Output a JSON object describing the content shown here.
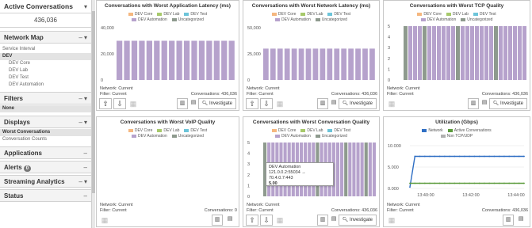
{
  "sidebar": {
    "active_conversations": {
      "title": "Active Conversations",
      "ctl": "▾",
      "value": "436,036"
    },
    "network_map": {
      "title": "Network Map",
      "ctl": "–  ▾",
      "items": [
        {
          "label": "Service Interval",
          "selected": false,
          "sub": false
        },
        {
          "label": "DEV",
          "selected": true,
          "sub": false
        },
        {
          "label": "DEV Core",
          "selected": false,
          "sub": true
        },
        {
          "label": "DEV Lab",
          "selected": false,
          "sub": true
        },
        {
          "label": "DEV Test",
          "selected": false,
          "sub": true
        },
        {
          "label": "DEV Automation",
          "selected": false,
          "sub": true
        }
      ]
    },
    "filters": {
      "title": "Filters",
      "ctl": "–  ▾",
      "items": [
        {
          "label": "None"
        }
      ]
    },
    "displays": {
      "title": "Displays",
      "ctl": "–  ▾",
      "items": [
        {
          "label": "Worst Conversations"
        },
        {
          "label": "Conversation Counts"
        }
      ]
    },
    "applications": {
      "title": "Applications",
      "ctl": "–"
    },
    "alerts": {
      "title": "Alerts",
      "badge": "0",
      "ctl": "–"
    },
    "streaming": {
      "title": "Streaming Analytics",
      "ctl": "–  ▾"
    },
    "status": {
      "title": "Status",
      "ctl": "–"
    }
  },
  "colors": {
    "dev_core": "#f5b77f",
    "dev_lab": "#a7c96b",
    "dev_test": "#6cc4d9",
    "dev_automation": "#b6a2cc",
    "uncategorized": "#8e9a8e",
    "network": "#2f6fc4",
    "active": "#5b9b3c",
    "non_tcp": "#b0b0b0"
  },
  "legend_std": {
    "row1": [
      "DEV Core",
      "DEV Lab",
      "DEV Test"
    ],
    "row2": [
      "DEV Automation",
      "Uncategorized"
    ]
  },
  "legend_util": {
    "row1": [
      "Network",
      "Active Conversations"
    ],
    "row2": [
      "Non TCP/UDP"
    ]
  },
  "panels": [
    {
      "title": "Conversations with Worst Application Latency (ms)",
      "network": "Network: Current",
      "filter": "Filter: Current",
      "conv": "Conversations: 436,036",
      "invest": "Investigate",
      "arrows": true,
      "ticks": [
        "40,000",
        "20,000",
        "0"
      ]
    },
    {
      "title": "Conversations with Worst Network Latency (ms)",
      "network": "Network: Current",
      "filter": "Filter: Current",
      "conv": "Conversations: 436,036",
      "invest": "Investigate",
      "arrows": true,
      "ticks": [
        "50,000",
        "25,000",
        "0"
      ]
    },
    {
      "title": "Conversations with Worst TCP Quality",
      "network": "Network: Current",
      "filter": "Filter: Current",
      "conv": "Conversations: 436,036",
      "invest": "Investigate",
      "arrows": false,
      "ticks": [
        "5",
        "4",
        "3",
        "2",
        "1",
        "0"
      ]
    },
    {
      "title": "Conversations with Worst VoIP Quality",
      "network": "Network: Current",
      "filter": "Filter: Current",
      "conv": "Conversations: 0",
      "invest": "",
      "arrows": false,
      "ticks": []
    },
    {
      "title": "Conversations with Worst Conversation Quality",
      "network": "Network: Current",
      "filter": "Filter: Current",
      "conv": "Conversations: 436,036",
      "invest": "Investigate",
      "arrows": true,
      "ticks": [
        "5",
        "4",
        "3",
        "2",
        "1",
        "0"
      ]
    },
    {
      "title": "Utilization (Gbps)",
      "network": "Network: Current",
      "filter": "Filter: Current",
      "conv": "Conversations: 436,036",
      "invest": "",
      "arrows": false,
      "ticks": [
        "10.000",
        "5.000",
        "0.000"
      ],
      "xticks": [
        "13:40:00",
        "13:42:00",
        "13:44:00"
      ]
    }
  ],
  "tooltip": {
    "label": "DEV Automation",
    "addr": "121.0.0.2:55034 → 70.4.0.7:443",
    "value": "5.00"
  },
  "chart_data": [
    {
      "type": "bar",
      "title": "Conversations with Worst Application Latency (ms)",
      "ylim": [
        0,
        40000
      ],
      "series": [
        {
          "name": "DEV Automation",
          "values": [
            30000,
            30000,
            30000,
            30000,
            30000,
            30000,
            30000,
            30000,
            30000,
            30000,
            30000,
            30000,
            30000,
            30000,
            30000,
            30000
          ]
        }
      ]
    },
    {
      "type": "bar",
      "title": "Conversations with Worst Network Latency (ms)",
      "ylim": [
        0,
        50000
      ],
      "series": [
        {
          "name": "DEV Automation",
          "values": [
            30000,
            30000,
            30000,
            30000,
            30000,
            30000,
            30000,
            30000,
            30000,
            30000,
            30000,
            30000,
            30000,
            30000,
            30000,
            30000
          ]
        }
      ]
    },
    {
      "type": "bar",
      "title": "Conversations with Worst TCP Quality",
      "ylim": [
        0,
        5
      ],
      "series": [
        {
          "name": "mixed",
          "values": [
            5,
            5,
            5,
            5,
            5,
            5,
            5,
            5,
            5,
            5,
            5,
            5,
            5,
            5,
            5,
            5,
            5,
            5,
            5,
            5,
            5,
            5,
            5,
            5,
            5,
            5
          ]
        }
      ],
      "colors": [
        "u",
        "a",
        "a",
        "a",
        "u",
        "a",
        "a",
        "a",
        "a",
        "a",
        "a",
        "u",
        "a",
        "a",
        "a",
        "a",
        "a",
        "a",
        "a",
        "u",
        "a",
        "a",
        "a",
        "a",
        "a",
        "a"
      ]
    },
    {
      "type": "bar",
      "title": "Conversations with Worst VoIP Quality",
      "series": []
    },
    {
      "type": "bar",
      "title": "Conversations with Worst Conversation Quality",
      "ylim": [
        0,
        5
      ],
      "series": [
        {
          "name": "mixed",
          "values": [
            5,
            5,
            5,
            5,
            5,
            5,
            5,
            5,
            5,
            5,
            5,
            5,
            5,
            5,
            5,
            5,
            5,
            5,
            5,
            5,
            5,
            5,
            5,
            5,
            5,
            5,
            5,
            5
          ]
        }
      ],
      "colors": [
        "u",
        "a",
        "a",
        "a",
        "a",
        "a",
        "a",
        "a",
        "a",
        "a",
        "a",
        "a",
        "a",
        "u",
        "a",
        "a",
        "a",
        "a",
        "a",
        "a",
        "u",
        "a",
        "a",
        "a",
        "a",
        "u",
        "a",
        "a"
      ]
    },
    {
      "type": "line",
      "title": "Utilization (Gbps)",
      "ylim": [
        0,
        10
      ],
      "series": [
        {
          "name": "Network",
          "values": [
            0.3,
            7.5,
            7.5,
            7.5,
            7.5,
            7.5,
            7.5,
            7.5,
            7.5,
            7.5,
            7.5,
            7.5,
            7.5,
            7.5,
            7.5,
            7.5,
            7.5,
            7.5,
            7.5,
            7.5,
            7.5,
            7.5,
            7.5,
            7.5
          ]
        },
        {
          "name": "Active Conversations",
          "values": [
            1.2,
            1.2,
            1.2,
            1.2,
            1.2,
            1.2,
            1.2,
            1.2,
            1.2,
            1.2,
            1.2,
            1.2,
            1.2,
            1.2,
            1.2,
            1.2,
            1.2,
            1.2,
            1.2,
            1.2,
            1.2,
            1.2,
            1.2,
            1.2
          ]
        }
      ]
    }
  ]
}
